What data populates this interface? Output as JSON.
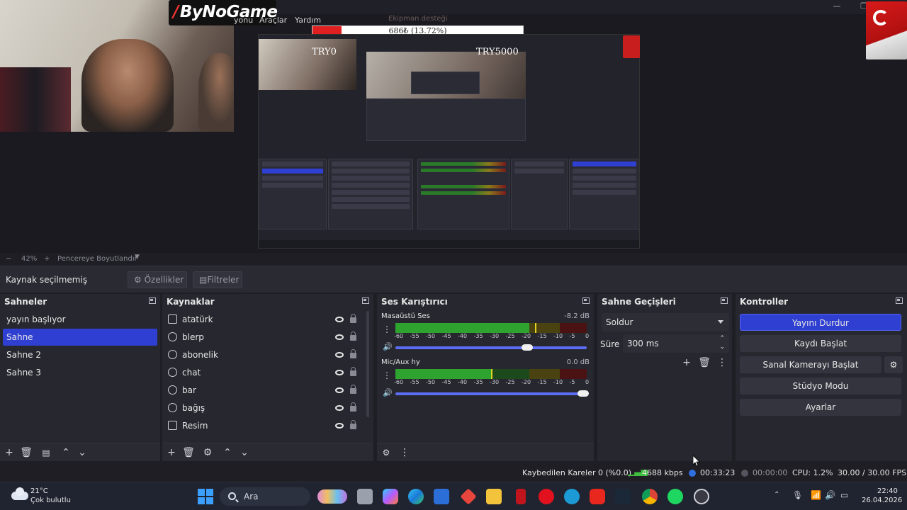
{
  "preview": {
    "logo_text": "ByNoGame",
    "menu_ghost": [
      "yonu",
      "Araçlar",
      "Yardım"
    ],
    "donation": {
      "title": "Ekipman desteği",
      "amount_text": "686₺ (13.72%)",
      "progress_fraction": 0.1372,
      "left_label": "TRY0",
      "right_label": "TRY5000"
    }
  },
  "zoom_bar": {
    "minus": "−",
    "zoom": "42%",
    "plus": "+",
    "fit_label": "Pencereye Boyutlandır"
  },
  "source_bar": {
    "no_source": "Kaynak seçilmemiş",
    "properties": "Özellikler",
    "filters": "Filtreler"
  },
  "scenes": {
    "title": "Sahneler",
    "items": [
      "yayın başlıyor",
      "Sahne",
      "Sahne 2",
      "Sahne 3"
    ],
    "selected_index": 1
  },
  "sources": {
    "title": "Kaynaklar",
    "items": [
      {
        "label": "atatürk",
        "icon": "image-icon"
      },
      {
        "label": "blerp",
        "icon": "browser-icon"
      },
      {
        "label": "abonelik",
        "icon": "browser-icon"
      },
      {
        "label": "chat",
        "icon": "browser-icon"
      },
      {
        "label": "bar",
        "icon": "browser-icon"
      },
      {
        "label": "bağış",
        "icon": "browser-icon"
      },
      {
        "label": "Resim",
        "icon": "image-icon"
      }
    ]
  },
  "mixer": {
    "title": "Ses Karıştırıcı",
    "tracks": [
      {
        "name": "Masaüstü Ses",
        "db": "-8.2 dB",
        "level_fraction": 0.7,
        "peak_fraction": 0.73,
        "volume_fraction": 0.69
      },
      {
        "name": "Mic/Aux hy",
        "db": "0.0 dB",
        "level_fraction": 0.5,
        "peak_fraction": 0.5,
        "volume_fraction": 0.98
      }
    ],
    "ticks": [
      "-60",
      "-55",
      "-50",
      "-45",
      "-40",
      "-35",
      "-30",
      "-25",
      "-20",
      "-15",
      "-10",
      "-5",
      "0"
    ]
  },
  "transitions": {
    "title": "Sahne Geçişleri",
    "selected": "Soldur",
    "duration_label": "Süre",
    "duration_value": "300 ms"
  },
  "controls": {
    "title": "Kontroller",
    "buttons": [
      "Yayını Durdur",
      "Kaydı Başlat",
      "Sanal Kamerayı Başlat",
      "Stüdyo Modu",
      "Ayarlar"
    ]
  },
  "status": {
    "dropped_frames": "Kaybedilen Kareler 0 (%0.0)",
    "bitrate": "4688 kbps",
    "stream_time": "00:33:23",
    "record_time": "00:00:00",
    "cpu": "CPU: 1.2%",
    "fps": "30.00 / 30.00 FPS"
  },
  "taskbar": {
    "weather_temp": "21°C",
    "weather_desc": "Çok bulutlu",
    "search_placeholder": "Ara",
    "time": "22:40",
    "date": "26.04.2026"
  },
  "colors": {
    "accent": "#2f3fd1",
    "panel": "#27272f",
    "background": "#1e1e24"
  }
}
